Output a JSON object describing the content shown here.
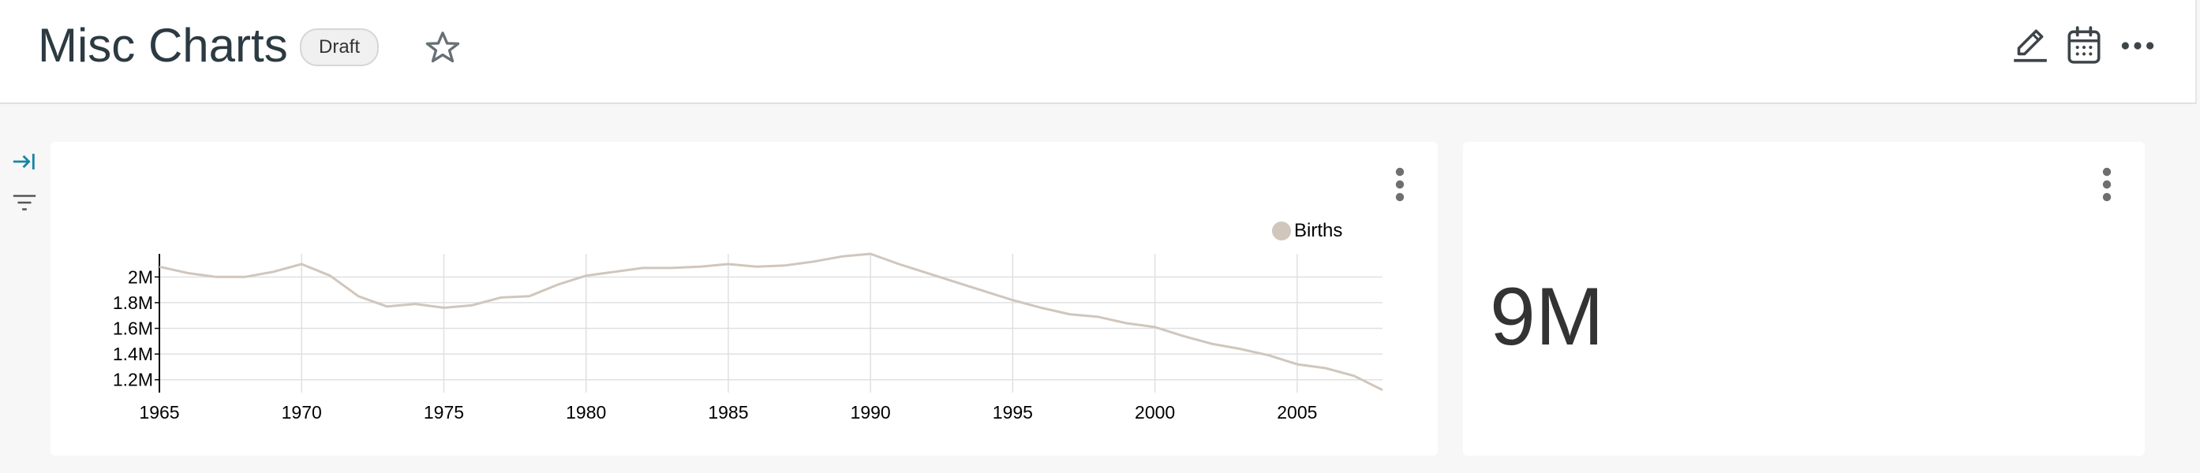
{
  "header": {
    "title": "Misc Charts",
    "badge": "Draft",
    "icons": [
      "star-icon",
      "edit-icon",
      "calendar-icon",
      "more-icon"
    ]
  },
  "rail": {
    "icons": [
      "expand-filters-icon",
      "filter-icon"
    ]
  },
  "cards": {
    "line_chart": {
      "menu_icon": "kebab-icon"
    },
    "big_number": {
      "value": "9M",
      "menu_icon": "kebab-icon"
    }
  },
  "colors": {
    "series": "#d1c6bc",
    "accent": "#1a85a0",
    "grid": "#e0e0e0"
  },
  "chart_data": {
    "type": "line",
    "title": "",
    "xlabel": "",
    "ylabel": "",
    "legend": "top-right",
    "grid": true,
    "xlim": [
      1965,
      2008
    ],
    "ylim": [
      1100000,
      2180000
    ],
    "x_ticks": [
      1965,
      1970,
      1975,
      1980,
      1985,
      1990,
      1995,
      2000,
      2005
    ],
    "x_tick_labels": [
      "1965",
      "1970",
      "1975",
      "1980",
      "1985",
      "1990",
      "1995",
      "2000",
      "2005"
    ],
    "y_ticks": [
      1200000,
      1400000,
      1600000,
      1800000,
      2000000
    ],
    "y_tick_labels": [
      "1.2M",
      "1.4M",
      "1.6M",
      "1.8M",
      "2M"
    ],
    "x": [
      1965,
      1966,
      1967,
      1968,
      1969,
      1970,
      1971,
      1972,
      1973,
      1974,
      1975,
      1976,
      1977,
      1978,
      1979,
      1980,
      1981,
      1982,
      1983,
      1984,
      1985,
      1986,
      1987,
      1988,
      1989,
      1990,
      1991,
      1992,
      1993,
      1994,
      1995,
      1996,
      1997,
      1998,
      1999,
      2000,
      2001,
      2002,
      2003,
      2004,
      2005,
      2006,
      2007,
      2008
    ],
    "series": [
      {
        "name": "Births",
        "values": [
          2080000,
          2030000,
          2000000,
          2000000,
          2040000,
          2100000,
          2010000,
          1850000,
          1770000,
          1790000,
          1760000,
          1780000,
          1840000,
          1850000,
          1940000,
          2010000,
          2040000,
          2070000,
          2070000,
          2080000,
          2100000,
          2080000,
          2090000,
          2120000,
          2160000,
          2180000,
          2100000,
          2030000,
          1960000,
          1890000,
          1820000,
          1760000,
          1710000,
          1690000,
          1640000,
          1610000,
          1540000,
          1480000,
          1440000,
          1390000,
          1320000,
          1290000,
          1230000,
          1120000
        ]
      }
    ]
  }
}
